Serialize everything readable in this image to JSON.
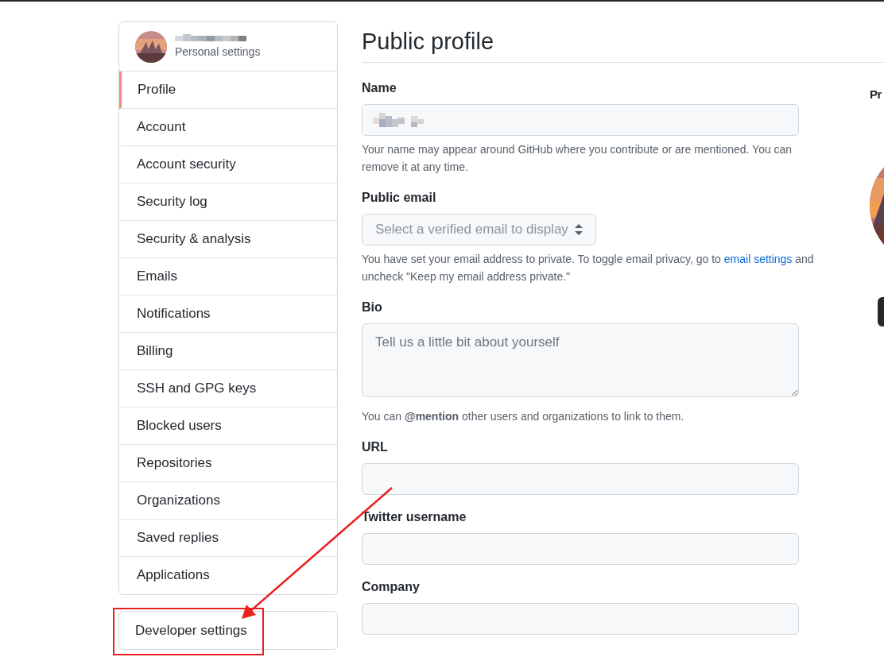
{
  "sidebar": {
    "header": {
      "subtitle": "Personal settings"
    },
    "items": [
      {
        "label": "Profile",
        "selected": true
      },
      {
        "label": "Account",
        "selected": false
      },
      {
        "label": "Account security",
        "selected": false
      },
      {
        "label": "Security log",
        "selected": false
      },
      {
        "label": "Security & analysis",
        "selected": false
      },
      {
        "label": "Emails",
        "selected": false
      },
      {
        "label": "Notifications",
        "selected": false
      },
      {
        "label": "Billing",
        "selected": false
      },
      {
        "label": "SSH and GPG keys",
        "selected": false
      },
      {
        "label": "Blocked users",
        "selected": false
      },
      {
        "label": "Repositories",
        "selected": false
      },
      {
        "label": "Organizations",
        "selected": false
      },
      {
        "label": "Saved replies",
        "selected": false
      },
      {
        "label": "Applications",
        "selected": false
      }
    ],
    "developer_settings": {
      "label": "Developer settings",
      "highlighted": true
    }
  },
  "main": {
    "title": "Public profile",
    "fields": [
      {
        "kind": "input",
        "label": "Name",
        "help": "Your name may appear around GitHub where you contribute or are mentioned. You can remove it at any time.",
        "redacted": true
      },
      {
        "kind": "select",
        "label": "Public email",
        "placeholder": "Select a verified email to display",
        "disabled": true,
        "help_parts": [
          "You have set your email address to private. To toggle email privacy, go to ",
          "email settings",
          " and uncheck \"Keep my email address private.\""
        ]
      },
      {
        "kind": "textarea",
        "label": "Bio",
        "placeholder": "Tell us a little bit about yourself",
        "help": "You can **@mention** other users and organizations to link to them."
      },
      {
        "kind": "input",
        "label": "URL"
      },
      {
        "kind": "input",
        "label": "Twitter username"
      },
      {
        "kind": "input",
        "label": "Company"
      }
    ]
  },
  "right_column": {
    "heading": "Pr"
  },
  "annotation": {
    "arrow": true
  }
}
